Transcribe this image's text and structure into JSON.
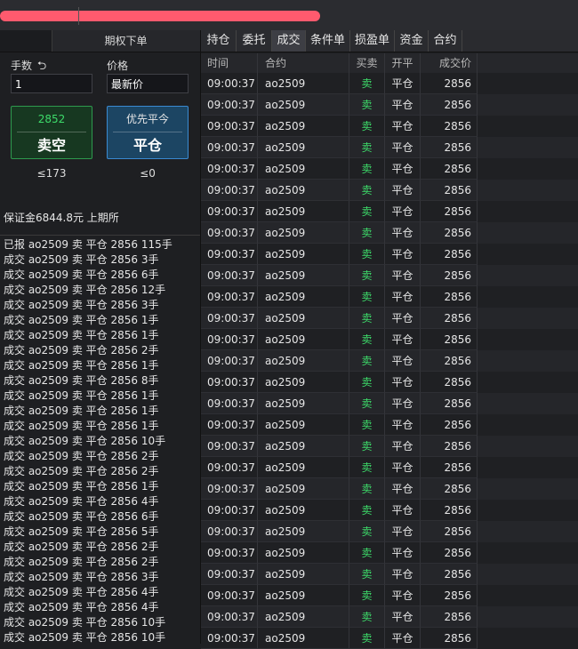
{
  "left_panel": {
    "title": "期权下单",
    "qty_label": "手数",
    "qty_reset_icon": "undo-icon",
    "price_label": "价格",
    "qty_value": "1",
    "price_value": "最新价",
    "sell_button": {
      "price": "2852",
      "label": "卖空",
      "limit": "≤173"
    },
    "close_button": {
      "top_label": "优先平今",
      "label": "平仓",
      "limit": "≤0"
    },
    "margin_info": "保证金6844.8元 上期所",
    "log_lines": [
      "已报 ao2509 卖 平仓 2856 115手",
      "成交 ao2509 卖 平仓 2856 3手",
      "成交 ao2509 卖 平仓 2856 6手",
      "成交 ao2509 卖 平仓 2856 12手",
      "成交 ao2509 卖 平仓 2856 3手",
      "成交 ao2509 卖 平仓 2856 1手",
      "成交 ao2509 卖 平仓 2856 1手",
      "成交 ao2509 卖 平仓 2856 2手",
      "成交 ao2509 卖 平仓 2856 1手",
      "成交 ao2509 卖 平仓 2856 8手",
      "成交 ao2509 卖 平仓 2856 1手",
      "成交 ao2509 卖 平仓 2856 1手",
      "成交 ao2509 卖 平仓 2856 1手",
      "成交 ao2509 卖 平仓 2856 10手",
      "成交 ao2509 卖 平仓 2856 2手",
      "成交 ao2509 卖 平仓 2856 2手",
      "成交 ao2509 卖 平仓 2856 1手",
      "成交 ao2509 卖 平仓 2856 4手",
      "成交 ao2509 卖 平仓 2856 6手",
      "成交 ao2509 卖 平仓 2856 5手",
      "成交 ao2509 卖 平仓 2856 2手",
      "成交 ao2509 卖 平仓 2856 2手",
      "成交 ao2509 卖 平仓 2856 3手",
      "成交 ao2509 卖 平仓 2856 4手",
      "成交 ao2509 卖 平仓 2856 4手",
      "成交 ao2509 卖 平仓 2856 10手",
      "成交 ao2509 卖 平仓 2856 10手"
    ]
  },
  "tabs": [
    "持仓",
    "委托",
    "成交",
    "条件单",
    "损盈单",
    "资金",
    "合约"
  ],
  "active_tab": "成交",
  "table": {
    "headers": [
      "时间",
      "合约",
      "买卖",
      "开平",
      "成交价"
    ],
    "rows": [
      [
        "09:00:37",
        "ao2509",
        "卖",
        "平仓",
        "2856"
      ],
      [
        "09:00:37",
        "ao2509",
        "卖",
        "平仓",
        "2856"
      ],
      [
        "09:00:37",
        "ao2509",
        "卖",
        "平仓",
        "2856"
      ],
      [
        "09:00:37",
        "ao2509",
        "卖",
        "平仓",
        "2856"
      ],
      [
        "09:00:37",
        "ao2509",
        "卖",
        "平仓",
        "2856"
      ],
      [
        "09:00:37",
        "ao2509",
        "卖",
        "平仓",
        "2856"
      ],
      [
        "09:00:37",
        "ao2509",
        "卖",
        "平仓",
        "2856"
      ],
      [
        "09:00:37",
        "ao2509",
        "卖",
        "平仓",
        "2856"
      ],
      [
        "09:00:37",
        "ao2509",
        "卖",
        "平仓",
        "2856"
      ],
      [
        "09:00:37",
        "ao2509",
        "卖",
        "平仓",
        "2856"
      ],
      [
        "09:00:37",
        "ao2509",
        "卖",
        "平仓",
        "2856"
      ],
      [
        "09:00:37",
        "ao2509",
        "卖",
        "平仓",
        "2856"
      ],
      [
        "09:00:37",
        "ao2509",
        "卖",
        "平仓",
        "2856"
      ],
      [
        "09:00:37",
        "ao2509",
        "卖",
        "平仓",
        "2856"
      ],
      [
        "09:00:37",
        "ao2509",
        "卖",
        "平仓",
        "2856"
      ],
      [
        "09:00:37",
        "ao2509",
        "卖",
        "平仓",
        "2856"
      ],
      [
        "09:00:37",
        "ao2509",
        "卖",
        "平仓",
        "2856"
      ],
      [
        "09:00:37",
        "ao2509",
        "卖",
        "平仓",
        "2856"
      ],
      [
        "09:00:37",
        "ao2509",
        "卖",
        "平仓",
        "2856"
      ],
      [
        "09:00:37",
        "ao2509",
        "卖",
        "平仓",
        "2856"
      ],
      [
        "09:00:37",
        "ao2509",
        "卖",
        "平仓",
        "2856"
      ],
      [
        "09:00:37",
        "ao2509",
        "卖",
        "平仓",
        "2856"
      ],
      [
        "09:00:37",
        "ao2509",
        "卖",
        "平仓",
        "2856"
      ],
      [
        "09:00:37",
        "ao2509",
        "卖",
        "平仓",
        "2856"
      ],
      [
        "09:00:37",
        "ao2509",
        "卖",
        "平仓",
        "2856"
      ],
      [
        "09:00:37",
        "ao2509",
        "卖",
        "平仓",
        "2856"
      ],
      [
        "09:00:37",
        "ao2509",
        "卖",
        "平仓",
        "2856"
      ]
    ]
  },
  "colors": {
    "sell_green": "#3ddc6a",
    "close_blue": "#3a8ad1",
    "redaction": "#ff5a6e"
  }
}
